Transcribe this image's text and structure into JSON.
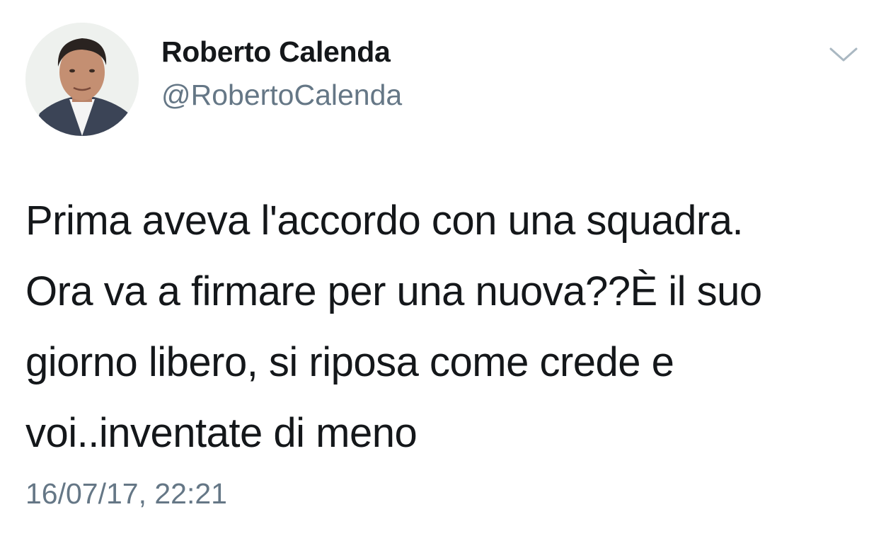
{
  "author": {
    "display_name": "Roberto Calenda",
    "handle": "@RobertoCalenda",
    "avatar_icon": "profile-photo"
  },
  "tweet": {
    "text": "Prima aveva l'accordo con una squadra.\nOra va a firmare per una nuova??È il suo\ngiorno libero, si riposa come crede e\nvoi..inventate di meno",
    "timestamp": "16/07/17, 22:21"
  },
  "menu": {
    "icon": "chevron-down-icon"
  },
  "colors": {
    "text": "#14171a",
    "secondary": "#657786",
    "chevron": "#aab8c2",
    "background": "#ffffff"
  }
}
